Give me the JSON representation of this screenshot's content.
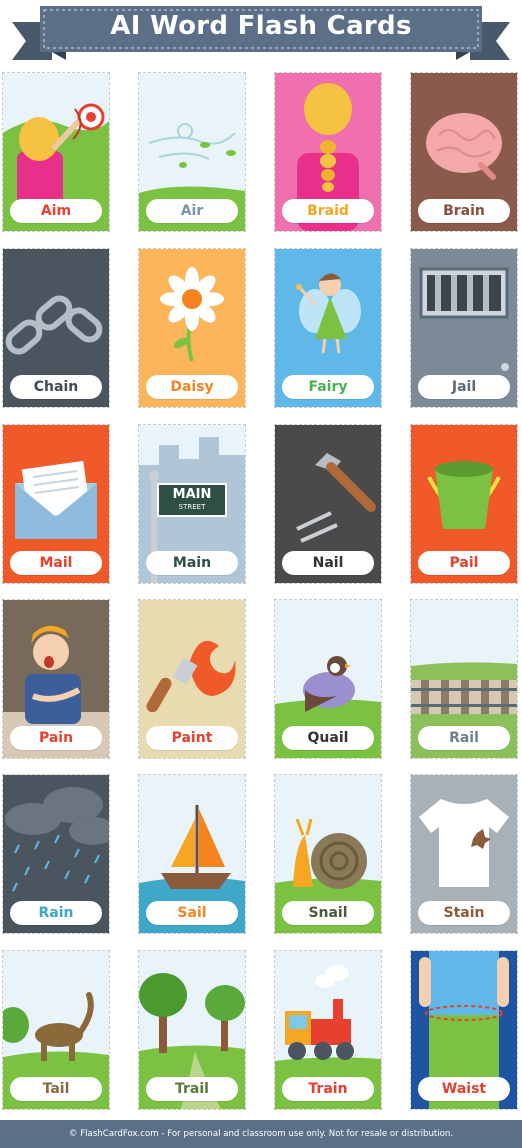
{
  "title": "AI Word Flash Cards",
  "footer": "© FlashCardFox.com - For personal and classroom use only. Not for resale or distribution.",
  "card_labels": [
    "Aim",
    "Air",
    "Braid",
    "Brain",
    "Chain",
    "Daisy",
    "Fairy",
    "Jail",
    "Mail",
    "Main",
    "Nail",
    "Pail",
    "Pain",
    "Paint",
    "Quail",
    "Rail",
    "Rain",
    "Sail",
    "Snail",
    "Stain",
    "Tail",
    "Trail",
    "Train",
    "Waist"
  ],
  "sign": {
    "line1": "MAIN",
    "line2": "STREET"
  },
  "colors": {
    "banner": "#5b7088",
    "footer": "#5b7088",
    "aim": "#e8402e",
    "air": "#7a96ad",
    "braid": "#f5a623",
    "brain": "#8a4b3c",
    "chain": "#3f4a55",
    "daisy": "#f5841f",
    "fairy": "#4caf50",
    "jail": "#5a6b78",
    "mail": "#e8402e",
    "main": "#2f4f45",
    "nail": "#333333",
    "pail": "#e8402e",
    "pain": "#e8402e",
    "paint": "#e8402e",
    "quail": "#333333",
    "rail": "#6b8090",
    "rain": "#3fa8c8",
    "sail": "#f5841f",
    "snail": "#4a5a3a",
    "stain": "#8a5a3a",
    "tail": "#8a6a3a",
    "trail": "#5a7a3a",
    "train": "#e8402e",
    "waist": "#e8402e"
  }
}
